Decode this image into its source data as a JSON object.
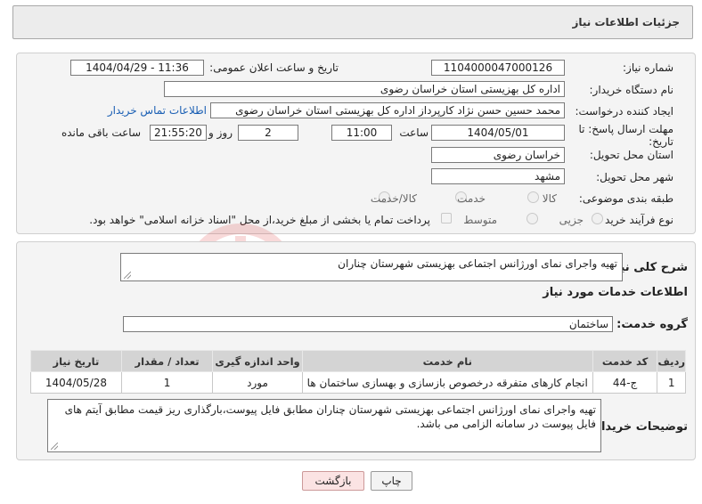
{
  "header": {
    "title": "جزئیات اطلاعات نیاز"
  },
  "form": {
    "need_number_label": "شماره نیاز:",
    "need_number": "1104000047000126",
    "announce_label": "تاریخ و ساعت اعلان عمومی:",
    "announce_value": "1404/04/29 - 11:36",
    "buyer_label": "نام دستگاه خریدار:",
    "buyer_value": "اداره کل بهزیستی استان خراسان رضوی",
    "creator_label": "ایجاد کننده درخواست:",
    "creator_value": "محمد حسین حسن نژاد کارپرداز اداره کل بهزیستی استان خراسان رضوی",
    "contact_link": "اطلاعات تماس خریدار",
    "deadline_label_1": "مهلت ارسال پاسخ: تا",
    "deadline_label_2": "تاریخ:",
    "deadline_date": "1404/05/01",
    "time_label": "ساعت",
    "deadline_time": "11:00",
    "days_value": "2",
    "days_label": "روز و",
    "remaining_time": "21:55:20",
    "remaining_label": "ساعت باقی مانده",
    "province_label": "استان محل تحویل:",
    "province_value": "خراسان رضوی",
    "city_label": "شهر محل تحویل:",
    "city_value": "مشهد",
    "category_label": "طبقه بندی موضوعی:",
    "category_options": [
      "کالا",
      "خدمت",
      "کالا/خدمت"
    ],
    "process_label": "نوع فرآیند خرید :",
    "process_options": [
      "جزیی",
      "متوسط"
    ],
    "payment_note": "پرداخت تمام یا بخشی از مبلغ خرید،از محل \"اسناد خزانه اسلامی\" خواهد بود."
  },
  "details": {
    "summary_label": "شرح کلی نیاز:",
    "summary_value": "تهیه واجرای نمای اورژانس اجتماعی بهزیستی شهرستان چناران",
    "services_title": "اطلاعات خدمات مورد نیاز",
    "service_group_label": "گروه خدمت:",
    "service_group_value": "ساختمان",
    "table": {
      "headers": [
        "ردیف",
        "کد خدمت",
        "نام خدمت",
        "واحد اندازه گیری",
        "تعداد / مقدار",
        "تاریخ نیاز"
      ],
      "rows": [
        [
          "1",
          "ج-44",
          "انجام کارهای متفرقه درخصوص بازسازی و بهسازی ساختمان ها",
          "مورد",
          "1",
          "1404/05/28"
        ]
      ]
    },
    "buyer_notes_label": "توضیحات خریدار:",
    "buyer_notes_value": "تهیه واجرای نمای اورژانس اجتماعی بهزیستی شهرستان چناران مطابق فایل پیوست،بارگذاری ریز قیمت مطابق آیتم های فایل پیوست در سامانه الزامی می باشد."
  },
  "buttons": {
    "print": "چاپ",
    "back": "بازگشت"
  },
  "watermark": {
    "text": "AriaTender.neT"
  },
  "colors": {
    "link": "#1a5fb4",
    "back_button": "#fbe3e3",
    "table_header": "#d4d4d4"
  }
}
